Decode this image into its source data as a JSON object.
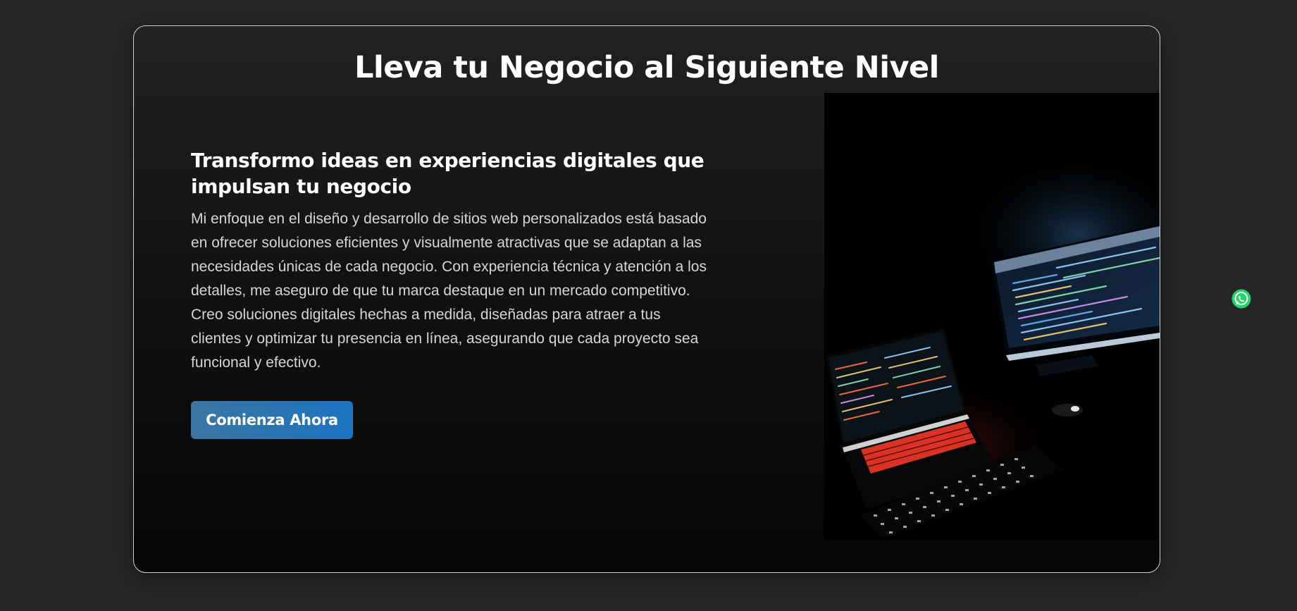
{
  "hero": {
    "title": "Lleva tu Negocio al Siguiente Nivel",
    "subheading": "Transformo ideas en experiencias digitales que impulsan tu negocio",
    "description": "Mi enfoque en el diseño y desarrollo de sitios web personalizados está basado en ofrecer soluciones eficientes y visualmente atractivas que se adaptan a las necesidades únicas de cada negocio. Con experiencia técnica y atención a los detalles, me aseguro de que tu marca destaque en un mercado competitivo. Creo soluciones digitales hechas a medida, diseñadas para atraer a tus clientes y optimizar tu presencia en línea, asegurando que cada proyecto sea funcional y efectivo.",
    "cta_label": "Comienza Ahora",
    "image_icon": "laptops-with-code-photo"
  },
  "floating": {
    "whatsapp_icon": "whatsapp-icon"
  },
  "colors": {
    "background": "#262626",
    "card_border": "#cfcfcf",
    "button_start": "#3b76a3",
    "button_end": "#1b73c2",
    "whatsapp": "#25d366"
  }
}
